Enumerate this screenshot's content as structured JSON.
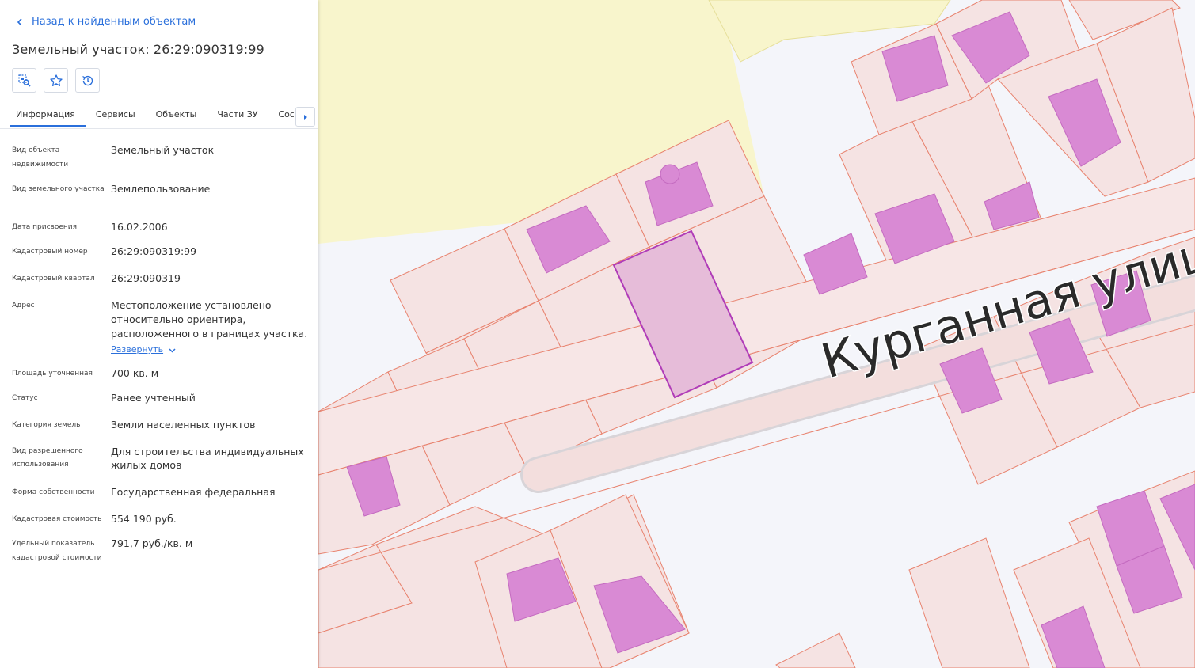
{
  "panel": {
    "back_label": "Назад к найденным объектам",
    "title": "Земельный участок: 26:29:090319:99",
    "tabs": [
      "Информация",
      "Сервисы",
      "Объекты",
      "Части ЗУ",
      "Состав Е"
    ],
    "active_tab": "Информация",
    "expand_label": "Развернуть",
    "properties": [
      {
        "label": "Вид объекта недвижимости",
        "value": "Земельный участок"
      },
      {
        "label": "Вид земельного участка",
        "value": "Землепользование"
      },
      {
        "label": "Дата присвоения",
        "value": "16.02.2006"
      },
      {
        "label": "Кадастровый номер",
        "value": "26:29:090319:99"
      },
      {
        "label": "Кадастровый квартал",
        "value": "26:29:090319"
      },
      {
        "label": "Адрес",
        "value": "Местоположение установлено относительно ориентира, расположенного в границах участка."
      },
      {
        "label": "Площадь уточненная",
        "value": "700 кв. м"
      },
      {
        "label": "Статус",
        "value": "Ранее учтенный"
      },
      {
        "label": "Категория земель",
        "value": "Земли населенных пунктов"
      },
      {
        "label": "Вид разрешенного использования",
        "value": "Для строительства индивидуальных жилых домов"
      },
      {
        "label": "Форма собственности",
        "value": "Государственная федеральная"
      },
      {
        "label": "Кадастровая стоимость",
        "value": "554 190 руб."
      },
      {
        "label": "Удельный показатель кадастровой стоимости",
        "value": "791,7 руб./кв. м"
      }
    ]
  },
  "map": {
    "street_label": "Курганная улица",
    "colors": {
      "background": "#f4f5fa",
      "parcel_fill": "#f5e3e3",
      "parcel_stroke": "#e8836f",
      "building_fill": "#d98ad4",
      "selected_fill": "#e6bcd9",
      "selected_stroke": "#b03cb8",
      "zone_fill": "#f8f5cc",
      "accent": "#2a6fdb"
    }
  }
}
